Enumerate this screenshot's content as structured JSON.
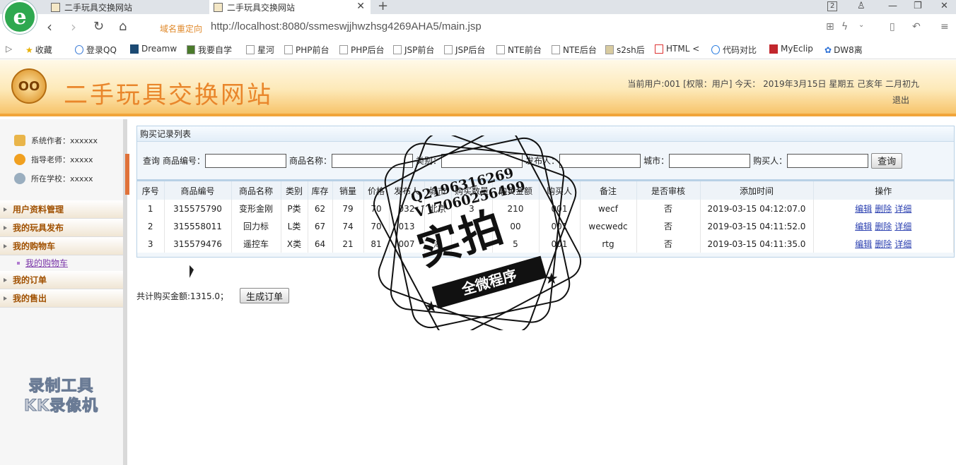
{
  "browser": {
    "tabs": [
      {
        "title": "二手玩具交换网站"
      },
      {
        "title": "二手玩具交换网站"
      }
    ],
    "tab_badge": "2",
    "redirect_label": "域名重定向",
    "url": "http://localhost:8080/ssmeswjjhwzhsg4269AHA5/main.jsp",
    "bookmarks": [
      "收藏",
      "登录QQ",
      "Dreamw",
      "我要自学",
      "星河",
      "PHP前台",
      "PHP后台",
      "JSP前台",
      "JSP后台",
      "NTE前台",
      "NTE后台",
      "s2sh后",
      "HTML <",
      "代码对比",
      "MyEclip",
      "DW8离"
    ]
  },
  "site": {
    "logo_text": "OO",
    "title": "二手玩具交换网站",
    "userinfo": "当前用户:001 [权限：用户] 今天： 2019年3月15日 星期五 己亥年 二月初九",
    "logout": "退出"
  },
  "sidebar": {
    "info": [
      {
        "label": "系统作者：xxxxxx"
      },
      {
        "label": "指导老师：xxxxx"
      },
      {
        "label": "所在学校：xxxxx"
      }
    ],
    "menus": [
      {
        "label": "用户资料管理"
      },
      {
        "label": "我的玩具发布"
      },
      {
        "label": "我的购物车"
      },
      {
        "label": "我的订单"
      },
      {
        "label": "我的售出"
      }
    ],
    "sub_item": "我的购物车"
  },
  "panel": {
    "title": "购买记录列表",
    "search": {
      "prefix": "查询",
      "fields": [
        "商品编号：",
        "商品名称：",
        "类别：",
        "发布人：",
        "城市：",
        "购买人："
      ],
      "button": "查询"
    },
    "columns": [
      "序号",
      "商品编号",
      "商品名称",
      "类别",
      "库存",
      "销量",
      "价格",
      "发布人",
      "城市",
      "购买数量",
      "购买金额",
      "购买人",
      "备注",
      "是否审核",
      "添加时间",
      "操作"
    ],
    "rows": [
      {
        "no": "1",
        "code": "315575790",
        "name": "变形金刚",
        "cat": "P类",
        "stock": "62",
        "sales": "79",
        "price": "70",
        "publisher": "032",
        "city": "北京",
        "qty": "3",
        "amount": "210",
        "buyer": "001",
        "note": "wecf",
        "audit": "否",
        "time": "2019-03-15 04:12:07.0"
      },
      {
        "no": "2",
        "code": "315558011",
        "name": "回力标",
        "cat": "L类",
        "stock": "67",
        "sales": "74",
        "price": "70",
        "publisher": "013",
        "city": "",
        "qty": "",
        "amount": "00",
        "buyer": "001",
        "note": "wecwedc",
        "audit": "否",
        "time": "2019-03-15 04:11:52.0"
      },
      {
        "no": "3",
        "code": "315579476",
        "name": "遥控车",
        "cat": "X类",
        "stock": "64",
        "sales": "21",
        "price": "81",
        "publisher": "007",
        "city": "海",
        "qty": "",
        "amount": "5",
        "buyer": "001",
        "note": "rtg",
        "audit": "否",
        "time": "2019-03-15 04:11:35.0"
      }
    ],
    "actions": [
      "编辑",
      "删除",
      "详细"
    ]
  },
  "summary": {
    "total": "共计购买金额:1315.0；",
    "order_button": "生成订单"
  },
  "watermarks": {
    "recorder_line1": "录制工具",
    "recorder_line2": "KK录像机",
    "stamp_qq": "Q2196316269",
    "stamp_v": "V17060256499",
    "stamp_big": "实拍",
    "stamp_ribbon": "全微程序"
  }
}
